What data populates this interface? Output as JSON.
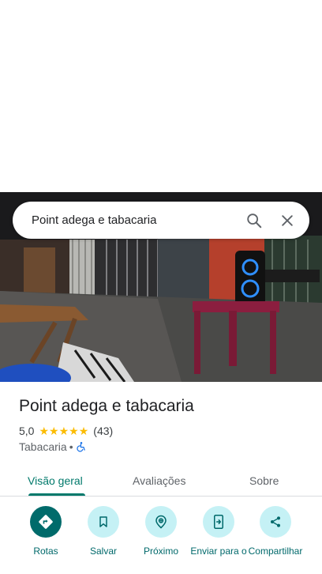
{
  "search": {
    "query": "Point adega e tabacaria"
  },
  "place": {
    "name": "Point adega e tabacaria",
    "rating": "5,0",
    "stars": 5,
    "review_count": "(43)",
    "category": "Tabacaria",
    "separator": "•"
  },
  "tabs": [
    {
      "label": "Visão geral",
      "active": true
    },
    {
      "label": "Avaliações",
      "active": false
    },
    {
      "label": "Sobre",
      "active": false
    }
  ],
  "actions": [
    {
      "label": "Rotas",
      "icon": "directions-icon"
    },
    {
      "label": "Salvar",
      "icon": "bookmark-icon"
    },
    {
      "label": "Próximo",
      "icon": "nearby-icon"
    },
    {
      "label": "Enviar para o",
      "icon": "send-to-phone-icon"
    },
    {
      "label": "Compartilhar",
      "icon": "share-icon"
    }
  ],
  "colors": {
    "accent": "#00796b",
    "star": "#fbbc04",
    "action_bg": "#c5f1f5",
    "action_primary": "#006b6b"
  }
}
